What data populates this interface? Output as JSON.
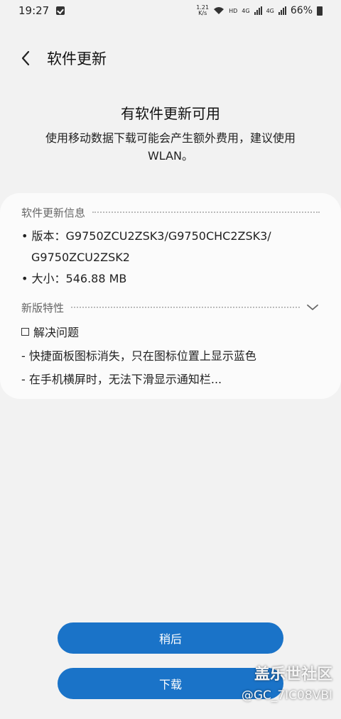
{
  "status_bar": {
    "time": "19:27",
    "speed_value": "1.21",
    "speed_unit": "K/s",
    "hd": "HD",
    "net1": "4G",
    "net2": "4G",
    "battery": "66%"
  },
  "app_bar": {
    "title": "软件更新"
  },
  "headline": "有软件更新可用",
  "subtext": "使用移动数据下载可能会产生额外费用，建议使用 WLAN。",
  "info": {
    "section_title": "软件更新信息",
    "version_line1": "• 版本：G9750ZCU2ZSK3/G9750CHC2ZSK3/",
    "version_line2": "G9750ZCU2ZSK2",
    "size_line": "• 大小：546.88 MB"
  },
  "features": {
    "section_title": "新版特性",
    "item0": "解决问题",
    "item1": "- 快捷面板图标消失，只在图标位置上显示蓝色",
    "item2": "- 在手机横屏时，无法下滑显示通知栏..."
  },
  "buttons": {
    "later": "稍后",
    "download": "下载"
  },
  "watermark": {
    "logo": "盖乐世社区",
    "user": "@GC_7IC08VBI"
  }
}
